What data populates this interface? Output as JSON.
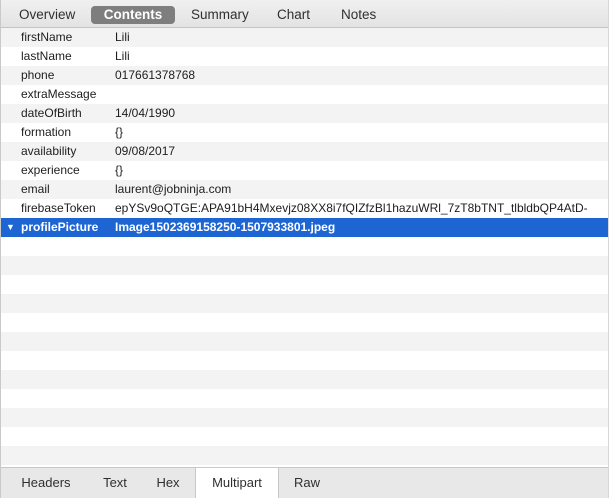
{
  "top_tabs": [
    {
      "label": "Overview",
      "active": false
    },
    {
      "label": "Contents",
      "active": true
    },
    {
      "label": "Summary",
      "active": false
    },
    {
      "label": "Chart",
      "active": false
    },
    {
      "label": "Notes",
      "active": false
    }
  ],
  "rows": [
    {
      "key": "firstName",
      "value": "Lili"
    },
    {
      "key": "lastName",
      "value": "Lili"
    },
    {
      "key": "phone",
      "value": "017661378768"
    },
    {
      "key": "extraMessage",
      "value": ""
    },
    {
      "key": "dateOfBirth",
      "value": "14/04/1990"
    },
    {
      "key": "formation",
      "value": "{}"
    },
    {
      "key": "availability",
      "value": "09/08/2017"
    },
    {
      "key": "experience",
      "value": "{}"
    },
    {
      "key": "email",
      "value": "laurent@jobninja.com"
    },
    {
      "key": "firebaseToken",
      "value": "epYSv9oQTGE:APA91bH4Mxevjz08XX8i7fQIZfzBl1hazuWRl_7zT8bTNT_tlbldbQP4AtD-"
    },
    {
      "key": "profilePicture",
      "value": "Image1502369158250-1507933801.jpeg",
      "selected": true
    }
  ],
  "selected_disclosure": "▼",
  "bottom_tabs": [
    {
      "label": "Headers",
      "active": false
    },
    {
      "label": "Text",
      "active": false
    },
    {
      "label": "Hex",
      "active": false
    },
    {
      "label": "Multipart",
      "active": true
    },
    {
      "label": "Raw",
      "active": false
    }
  ],
  "colors": {
    "selection": "#1d65d3",
    "active_top_tab": "#7e7e7e",
    "row_stripe": "#f3f3f3"
  }
}
